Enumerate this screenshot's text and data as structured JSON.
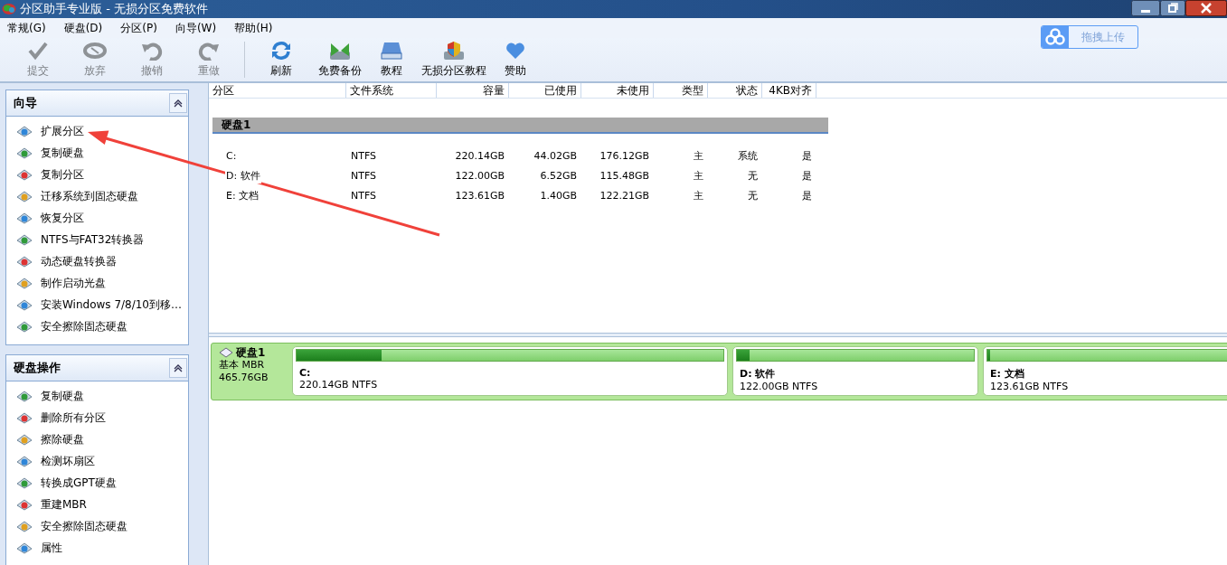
{
  "window": {
    "title": "分区助手专业版 - 无损分区免费软件"
  },
  "menu": [
    "常规(G)",
    "硬盘(D)",
    "分区(P)",
    "向导(W)",
    "帮助(H)"
  ],
  "toolbar": [
    {
      "label": "提交",
      "disabled": true
    },
    {
      "label": "放弃",
      "disabled": true
    },
    {
      "label": "撤销",
      "disabled": true
    },
    {
      "label": "重做",
      "disabled": true
    },
    {
      "label": "刷新",
      "disabled": false
    },
    {
      "label": "免费备份",
      "disabled": false
    },
    {
      "label": "教程",
      "disabled": false
    },
    {
      "label": "无损分区教程",
      "disabled": false
    },
    {
      "label": "赞助",
      "disabled": false
    }
  ],
  "upload_button": {
    "label": "拖拽上传"
  },
  "sidebar": {
    "panels": [
      {
        "title": "向导",
        "expanded": true,
        "items": [
          "扩展分区",
          "复制硬盘",
          "复制分区",
          "迁移系统到固态硬盘",
          "恢复分区",
          "NTFS与FAT32转换器",
          "动态硬盘转换器",
          "制作启动光盘",
          "安装Windows 7/8/10到移…",
          "安全擦除固态硬盘"
        ]
      },
      {
        "title": "硬盘操作",
        "expanded": true,
        "items": [
          "复制硬盘",
          "删除所有分区",
          "擦除硬盘",
          "检测坏扇区",
          "转换成GPT硬盘",
          "重建MBR",
          "安全擦除固态硬盘",
          "属性"
        ]
      }
    ]
  },
  "table": {
    "columns": [
      "分区",
      "文件系统",
      "容量",
      "已使用",
      "未使用",
      "类型",
      "状态",
      "4KB对齐"
    ],
    "groups": [
      {
        "title": "硬盘1",
        "rows": [
          [
            "C:",
            "NTFS",
            "220.14GB",
            "44.02GB",
            "176.12GB",
            "主",
            "系统",
            "是"
          ],
          [
            "D: 软件",
            "NTFS",
            "122.00GB",
            "6.52GB",
            "115.48GB",
            "主",
            "无",
            "是"
          ],
          [
            "E: 文档",
            "NTFS",
            "123.61GB",
            "1.40GB",
            "122.21GB",
            "主",
            "无",
            "是"
          ]
        ]
      }
    ]
  },
  "disk_map": {
    "disks": [
      {
        "name": "硬盘1",
        "type": "基本 MBR",
        "size": "465.76GB",
        "partitions": [
          {
            "name": "C:",
            "info": "220.14GB NTFS",
            "level": 0.2
          },
          {
            "name": "D: 软件",
            "info": "122.00GB NTFS",
            "level": 0.053
          },
          {
            "name": "E: 文档",
            "info": "123.61GB NTFS",
            "level": 0.011
          }
        ]
      }
    ]
  }
}
